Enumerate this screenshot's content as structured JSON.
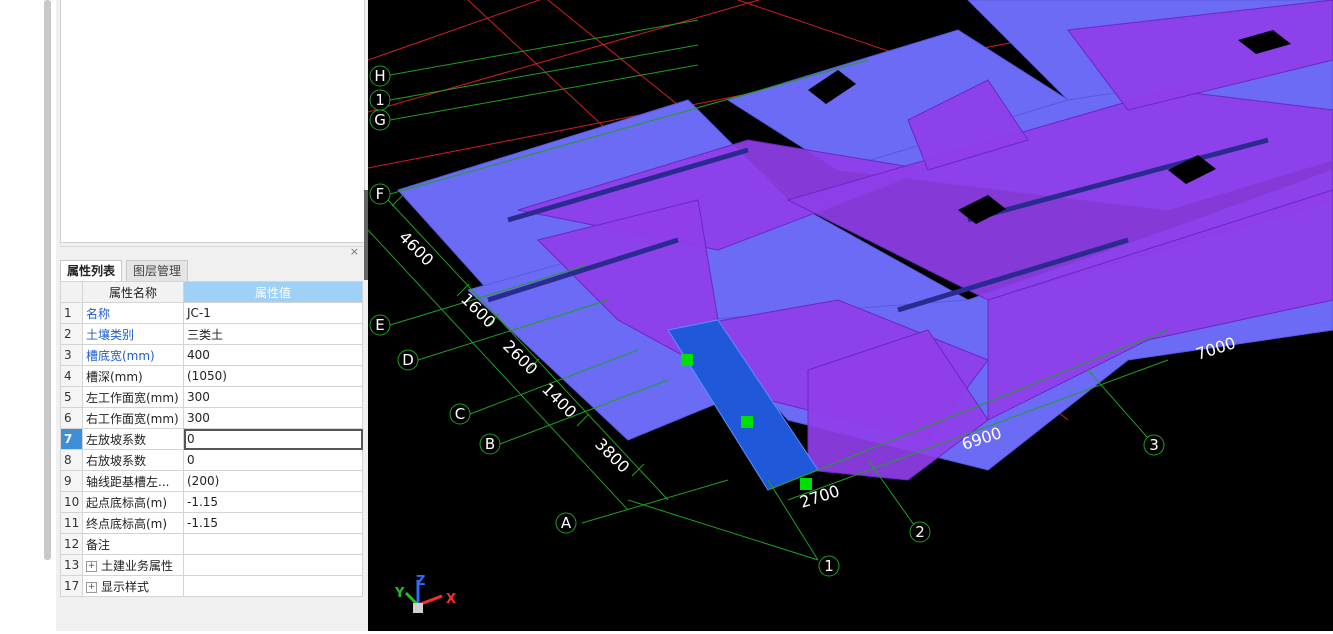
{
  "panel": {
    "close_glyph": "×",
    "tabs": [
      {
        "label": "属性列表",
        "active": true
      },
      {
        "label": "图层管理",
        "active": false
      }
    ],
    "table": {
      "headers": [
        "属性名称",
        "属性值"
      ],
      "rows": [
        {
          "num": "1",
          "name": "名称",
          "value": "JC-1",
          "blue": true
        },
        {
          "num": "2",
          "name": "土壤类别",
          "value": "三类土",
          "blue": true
        },
        {
          "num": "3",
          "name": "槽底宽(mm)",
          "value": "400",
          "blue": true
        },
        {
          "num": "4",
          "name": "槽深(mm)",
          "value": "(1050)",
          "blue": false
        },
        {
          "num": "5",
          "name": "左工作面宽(mm)",
          "value": "300",
          "blue": false
        },
        {
          "num": "6",
          "name": "右工作面宽(mm)",
          "value": "300",
          "blue": false
        },
        {
          "num": "7",
          "name": "左放坡系数",
          "value": "0",
          "blue": false,
          "selected": true
        },
        {
          "num": "8",
          "name": "右放坡系数",
          "value": "0",
          "blue": false
        },
        {
          "num": "9",
          "name": "轴线距基槽左...",
          "value": "(200)",
          "blue": false
        },
        {
          "num": "10",
          "name": "起点底标高(m)",
          "value": "-1.15",
          "blue": false
        },
        {
          "num": "11",
          "name": "终点底标高(m)",
          "value": "-1.15",
          "blue": false
        },
        {
          "num": "12",
          "name": "备注",
          "value": "",
          "blue": false
        },
        {
          "num": "13",
          "name": "土建业务属性",
          "value": "",
          "group": true
        },
        {
          "num": "17",
          "name": "显示样式",
          "value": "",
          "group": true
        }
      ]
    }
  },
  "viewport": {
    "axis_labels": {
      "letters": [
        "H",
        "1",
        "G",
        "F",
        "E",
        "D",
        "C",
        "B",
        "A"
      ],
      "numbers": [
        "1",
        "2",
        "3"
      ]
    },
    "dimensions": {
      "left": [
        "4600",
        "1600",
        "2600",
        "1400",
        "3800"
      ],
      "bottom": [
        "2700",
        "6900",
        "7000"
      ]
    },
    "triad": {
      "x": "X",
      "y": "Y",
      "z": "Z"
    },
    "colors": {
      "background": "#000000",
      "slab": "#6b6bf5",
      "beam": "#8f3ee8",
      "selected": "#1f58d8",
      "grip": "#00e000",
      "grid_green": "#1fa01f",
      "grid_red": "#d21e1e"
    }
  }
}
